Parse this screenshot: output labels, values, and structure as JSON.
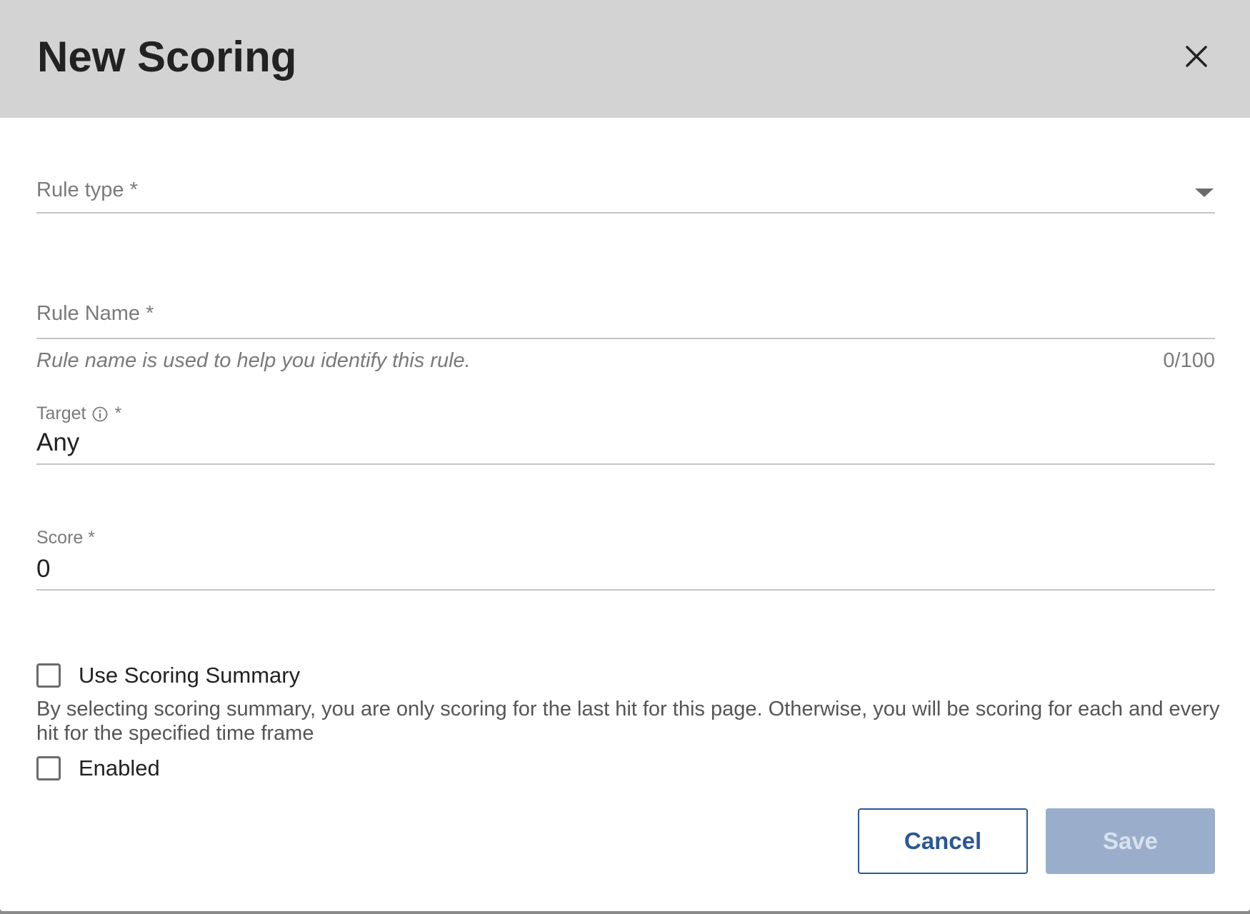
{
  "dialog": {
    "title": "New Scoring"
  },
  "fields": {
    "rule_type": {
      "label": "Rule type *"
    },
    "rule_name": {
      "label": "Rule Name *",
      "hint": "Rule name is used to help you identify this rule.",
      "counter": "0/100"
    },
    "target": {
      "label": "Target",
      "required_mark": "*",
      "value": "Any"
    },
    "score": {
      "label": "Score *",
      "value": "0"
    }
  },
  "options": {
    "scoring_summary": {
      "label": "Use Scoring Summary",
      "checked": false,
      "description": "By selecting scoring summary, you are only scoring for the last hit for this page. Otherwise, you will be scoring for each and every hit for the specified time frame"
    },
    "enabled": {
      "label": "Enabled",
      "checked": false
    }
  },
  "actions": {
    "cancel_label": "Cancel",
    "save_label": "Save"
  },
  "colors": {
    "header_bg": "#d3d3d3",
    "primary": "#2b5797",
    "save_disabled_bg": "#9aaecc"
  },
  "icons": {
    "close": "close-icon",
    "dropdown": "chevron-down-icon",
    "info": "info-icon"
  }
}
